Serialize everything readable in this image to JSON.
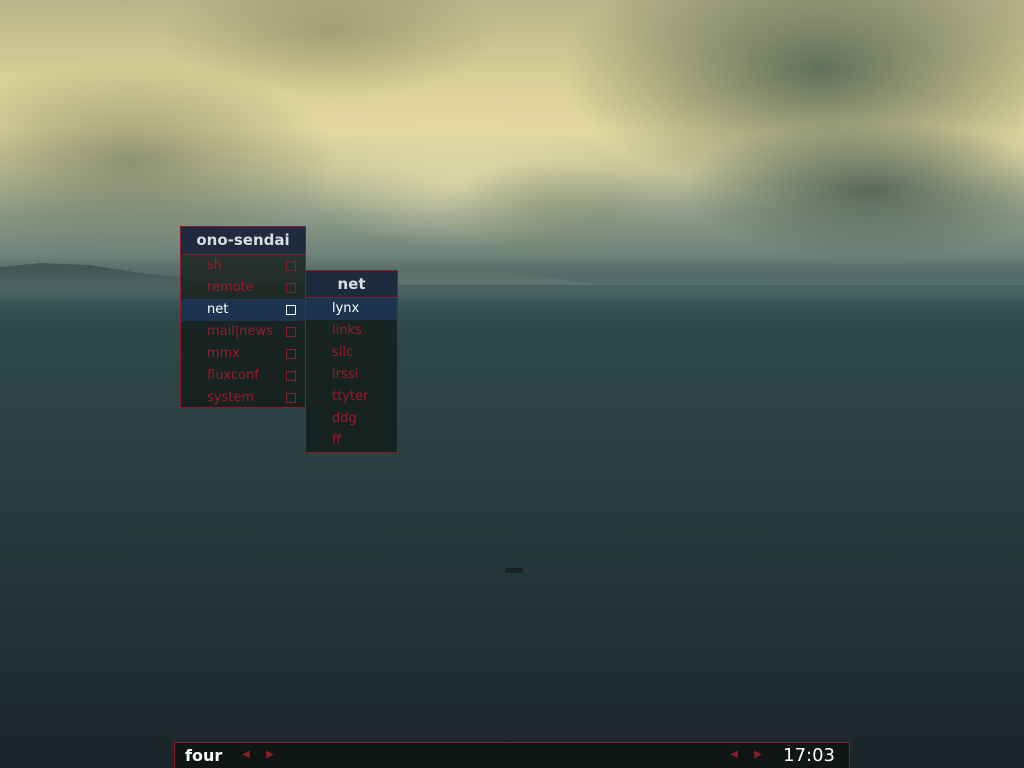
{
  "root_menu": {
    "title": "ono-sendai",
    "items": [
      {
        "label": "sh",
        "active": false
      },
      {
        "label": "remote",
        "active": false
      },
      {
        "label": "net",
        "active": true
      },
      {
        "label": "mail|news",
        "active": false
      },
      {
        "label": "mmx",
        "active": false
      },
      {
        "label": "fluxconf",
        "active": false
      },
      {
        "label": "system",
        "active": false
      }
    ]
  },
  "net_menu": {
    "title": "net",
    "items": [
      {
        "label": "lynx",
        "active": true
      },
      {
        "label": "links",
        "active": false
      },
      {
        "label": "silc",
        "active": false
      },
      {
        "label": "irssi",
        "active": false
      },
      {
        "label": "ttyter",
        "active": false
      },
      {
        "label": "ddg",
        "active": false
      },
      {
        "label": "ff",
        "active": false
      }
    ]
  },
  "toolbar": {
    "workspace": "four",
    "workspace_prev_icon": "left-triangle-icon",
    "workspace_next_icon": "right-triangle-icon",
    "window_prev_icon": "left-triangle-icon",
    "window_next_icon": "right-triangle-icon",
    "clock": "17:03"
  },
  "colors": {
    "menu_border": "#8a1b2a",
    "menu_text": "#9c1a2b",
    "menu_title_bg": "#1f2a3c",
    "active_bg": "#1c3450",
    "active_text": "#ffffff"
  }
}
